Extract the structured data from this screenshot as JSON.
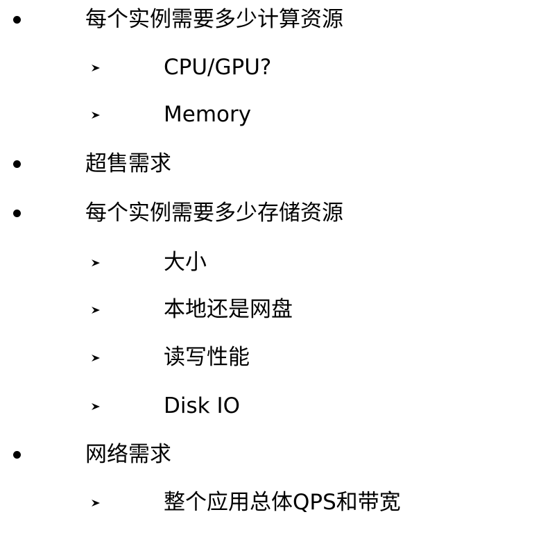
{
  "items": [
    {
      "level": 1,
      "label": "每个实例需要多少计算资源"
    },
    {
      "level": 2,
      "label": "CPU/GPU?"
    },
    {
      "level": 2,
      "label": "Memory"
    },
    {
      "level": 1,
      "label": "超售需求"
    },
    {
      "level": 1,
      "label": "每个实例需要多少存储资源"
    },
    {
      "level": 2,
      "label": "大小"
    },
    {
      "level": 2,
      "label": "本地还是网盘"
    },
    {
      "level": 2,
      "label": "读写性能"
    },
    {
      "level": 2,
      "label": "Disk IO"
    },
    {
      "level": 1,
      "label": "网络需求"
    },
    {
      "level": 2,
      "label": "整个应用总体QPS和带宽"
    }
  ]
}
